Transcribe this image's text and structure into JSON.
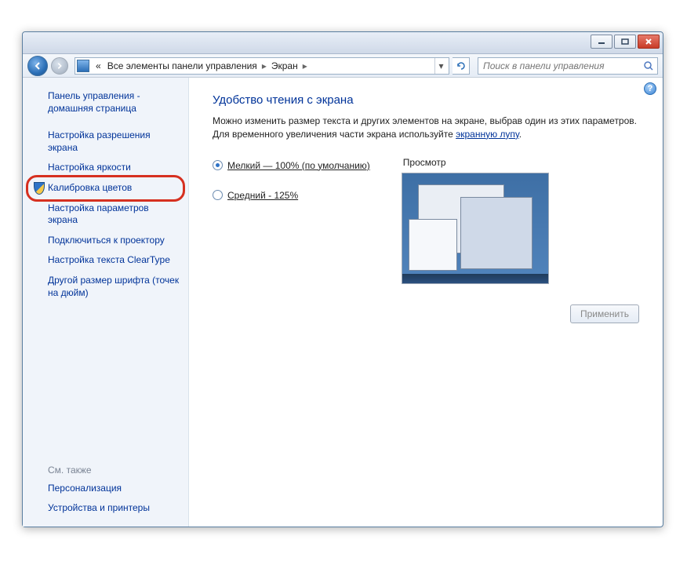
{
  "breadcrumb": {
    "prefix": "«",
    "parent": "Все элементы панели управления",
    "current": "Экран"
  },
  "search": {
    "placeholder": "Поиск в панели управления"
  },
  "sidebar": {
    "home": "Панель управления - домашняя страница",
    "links": [
      "Настройка разрешения экрана",
      "Настройка яркости",
      "Калибровка цветов",
      "Настройка параметров экрана",
      "Подключиться к проектору",
      "Настройка текста ClearType",
      "Другой размер шрифта (точек на дюйм)"
    ],
    "see_also_header": "См. также",
    "see_also": [
      "Персонализация",
      "Устройства и принтеры"
    ]
  },
  "content": {
    "title": "Удобство чтения с экрана",
    "description_pre": "Можно изменить размер текста и других элементов на экране, выбрав один из этих параметров. Для временного увеличения части экрана используйте ",
    "description_link": "экранную лупу",
    "description_post": ".",
    "options": {
      "small": "Мелкий — 100% (по умолчанию)",
      "medium": "Средний - 125%"
    },
    "preview_label": "Просмотр",
    "apply_label": "Применить"
  }
}
